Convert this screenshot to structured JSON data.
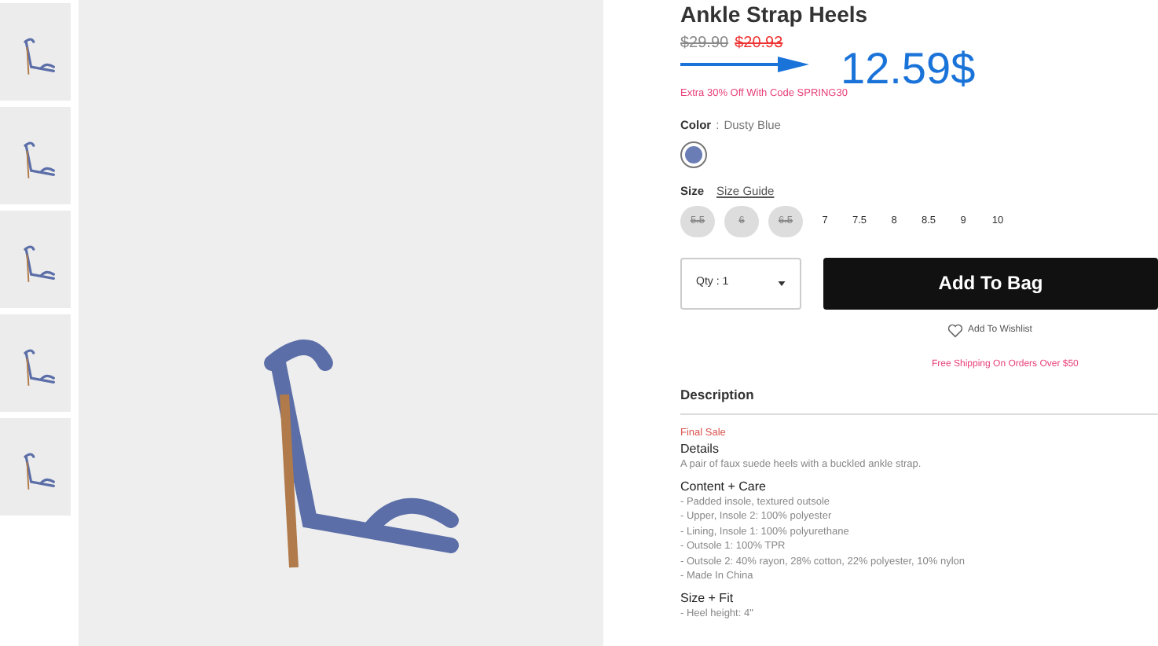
{
  "thumbnails": [
    {
      "selected": false
    },
    {
      "selected": false
    },
    {
      "selected": false
    },
    {
      "selected": false
    },
    {
      "selected": false
    }
  ],
  "product": {
    "title": "Ankle Strap Heels",
    "old_price": "$29.90",
    "sale_price": "$20.93",
    "overlay_price": "12.59$",
    "promo": "Extra 30% Off With Code SPRING30",
    "color_label": "Color",
    "color_separator": ":",
    "color_name": "Dusty Blue",
    "swatches": [
      {
        "color": "#6a7db5",
        "selected": true
      }
    ],
    "size_label": "Size",
    "size_guide": "Size Guide",
    "sizes": [
      {
        "label": "5.5",
        "disabled": true
      },
      {
        "label": "6",
        "disabled": true
      },
      {
        "label": "6.5",
        "disabled": true
      },
      {
        "label": "7",
        "disabled": false
      },
      {
        "label": "7.5",
        "disabled": false
      },
      {
        "label": "8",
        "disabled": false
      },
      {
        "label": "8.5",
        "disabled": false
      },
      {
        "label": "9",
        "disabled": false
      },
      {
        "label": "10",
        "disabled": false
      }
    ],
    "quantity": "Qty : 1",
    "add_to_bag": "Add To Bag",
    "wishlist": "Add To Wishlist",
    "shipping": "Free Shipping On Orders Over $50"
  },
  "description": {
    "heading": "Description",
    "final_sale": "Final Sale",
    "sections": [
      {
        "heading": "Details",
        "lines": [
          "A pair of faux suede heels with a buckled ankle strap."
        ]
      },
      {
        "heading": "Content + Care",
        "lines": [
          "- Padded insole, textured outsole",
          "- Upper, Insole 2: 100% polyester",
          "- Lining, Insole 1: 100% polyurethane",
          "- Outsole 1: 100% TPR",
          "- Outsole 2: 40% rayon, 28% cotton, 22% polyester, 10% nylon",
          "- Made In China"
        ]
      },
      {
        "heading": "Size + Fit",
        "lines": [
          "- Heel height: 4\""
        ]
      }
    ]
  }
}
